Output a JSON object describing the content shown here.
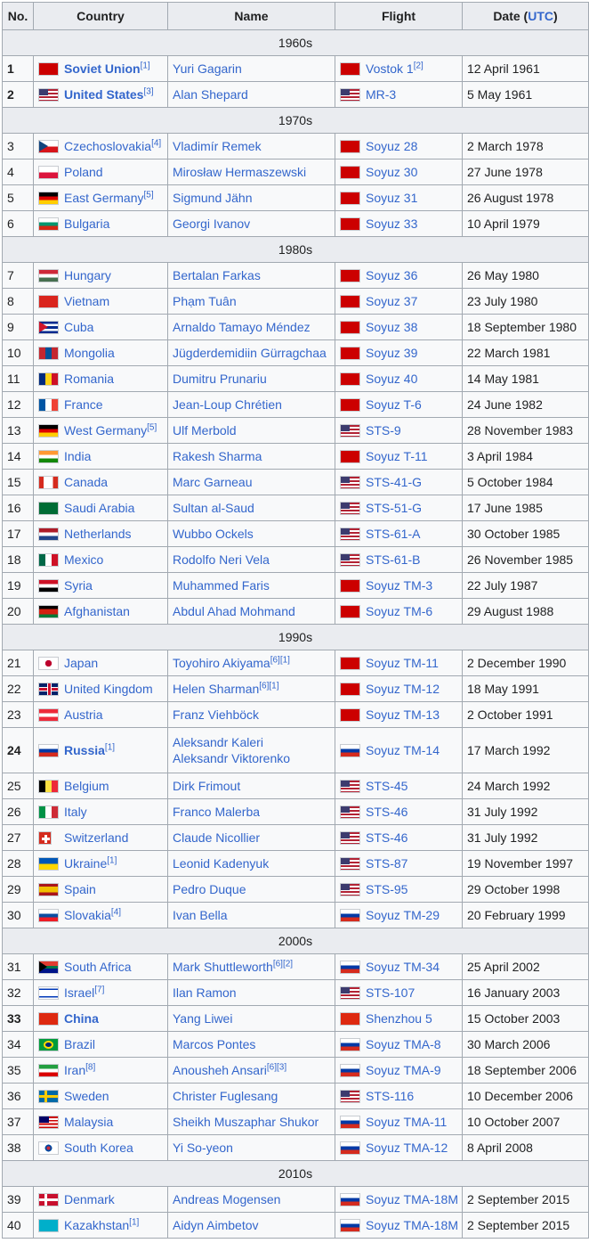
{
  "headers": {
    "no": "No.",
    "country": "Country",
    "name": "Name",
    "flight": "Flight",
    "date_prefix": "Date (",
    "date_link": "UTC",
    "date_suffix": ")"
  },
  "decades": [
    "1960s",
    "1970s",
    "1980s",
    "1990s",
    "2000s",
    "2010s"
  ],
  "rows": [
    {
      "no": "1",
      "bold": true,
      "country": "Soviet Union",
      "country_flag": "ussr-flag-icon",
      "csup": "[1]",
      "name": "Yuri Gagarin",
      "name2": "",
      "nsup": "",
      "flight": "Vostok 1",
      "fsup": "[2]",
      "flight_flag": "ussr-flag-icon",
      "date": "12 April 1961"
    },
    {
      "no": "2",
      "bold": true,
      "country": "United States",
      "country_flag": "usa-flag-icon",
      "csup": "[3]",
      "name": "Alan Shepard",
      "name2": "",
      "nsup": "",
      "flight": "MR-3",
      "fsup": "",
      "flight_flag": "usa-flag-icon",
      "date": "5 May 1961"
    },
    {
      "no": "3",
      "bold": false,
      "country": "Czechoslovakia",
      "country_flag": "czechoslovakia-flag-icon",
      "csup": "[4]",
      "name": "Vladimír Remek",
      "name2": "",
      "nsup": "",
      "flight": "Soyuz 28",
      "fsup": "",
      "flight_flag": "ussr-flag-icon",
      "date": "2 March 1978"
    },
    {
      "no": "4",
      "bold": false,
      "country": "Poland",
      "country_flag": "poland-flag-icon",
      "csup": "",
      "name": "Mirosław Hermaszewski",
      "name2": "",
      "nsup": "",
      "flight": "Soyuz 30",
      "fsup": "",
      "flight_flag": "ussr-flag-icon",
      "date": "27 June 1978"
    },
    {
      "no": "5",
      "bold": false,
      "country": "East Germany",
      "country_flag": "east-germany-flag-icon",
      "csup": "[5]",
      "name": "Sigmund Jähn",
      "name2": "",
      "nsup": "",
      "flight": "Soyuz 31",
      "fsup": "",
      "flight_flag": "ussr-flag-icon",
      "date": "26 August 1978"
    },
    {
      "no": "6",
      "bold": false,
      "country": "Bulgaria",
      "country_flag": "bulgaria-flag-icon",
      "csup": "",
      "name": "Georgi Ivanov",
      "name2": "",
      "nsup": "",
      "flight": "Soyuz 33",
      "fsup": "",
      "flight_flag": "ussr-flag-icon",
      "date": "10 April 1979"
    },
    {
      "no": "7",
      "bold": false,
      "country": "Hungary",
      "country_flag": "hungary-flag-icon",
      "csup": "",
      "name": "Bertalan Farkas",
      "name2": "",
      "nsup": "",
      "flight": "Soyuz 36",
      "fsup": "",
      "flight_flag": "ussr-flag-icon",
      "date": "26 May 1980"
    },
    {
      "no": "8",
      "bold": false,
      "country": "Vietnam",
      "country_flag": "vietnam-flag-icon",
      "csup": "",
      "name": "Phạm Tuân",
      "name2": "",
      "nsup": "",
      "flight": "Soyuz 37",
      "fsup": "",
      "flight_flag": "ussr-flag-icon",
      "date": "23 July 1980"
    },
    {
      "no": "9",
      "bold": false,
      "country": "Cuba",
      "country_flag": "cuba-flag-icon",
      "csup": "",
      "name": "Arnaldo Tamayo Méndez",
      "name2": "",
      "nsup": "",
      "flight": "Soyuz 38",
      "fsup": "",
      "flight_flag": "ussr-flag-icon",
      "date": "18 September 1980"
    },
    {
      "no": "10",
      "bold": false,
      "country": "Mongolia",
      "country_flag": "mongolia-flag-icon",
      "csup": "",
      "name": "Jügderdemidiin Gürragchaa",
      "name2": "",
      "nsup": "",
      "flight": "Soyuz 39",
      "fsup": "",
      "flight_flag": "ussr-flag-icon",
      "date": "22 March 1981"
    },
    {
      "no": "11",
      "bold": false,
      "country": "Romania",
      "country_flag": "romania-flag-icon",
      "csup": "",
      "name": "Dumitru Prunariu",
      "name2": "",
      "nsup": "",
      "flight": "Soyuz 40",
      "fsup": "",
      "flight_flag": "ussr-flag-icon",
      "date": "14 May 1981"
    },
    {
      "no": "12",
      "bold": false,
      "country": "France",
      "country_flag": "france-flag-icon",
      "csup": "",
      "name": "Jean-Loup Chrétien",
      "name2": "",
      "nsup": "",
      "flight": "Soyuz T-6",
      "fsup": "",
      "flight_flag": "ussr-flag-icon",
      "date": "24 June 1982"
    },
    {
      "no": "13",
      "bold": false,
      "country": "West Germany",
      "country_flag": "west-germany-flag-icon",
      "csup": "[5]",
      "name": "Ulf Merbold",
      "name2": "",
      "nsup": "",
      "flight": "STS-9",
      "fsup": "",
      "flight_flag": "usa-flag-icon",
      "date": "28 November 1983"
    },
    {
      "no": "14",
      "bold": false,
      "country": "India",
      "country_flag": "india-flag-icon",
      "csup": "",
      "name": "Rakesh Sharma",
      "name2": "",
      "nsup": "",
      "flight": "Soyuz T-11",
      "fsup": "",
      "flight_flag": "ussr-flag-icon",
      "date": "3 April 1984"
    },
    {
      "no": "15",
      "bold": false,
      "country": "Canada",
      "country_flag": "canada-flag-icon",
      "csup": "",
      "name": "Marc Garneau",
      "name2": "",
      "nsup": "",
      "flight": "STS-41-G",
      "fsup": "",
      "flight_flag": "usa-flag-icon",
      "date": "5 October 1984"
    },
    {
      "no": "16",
      "bold": false,
      "country": "Saudi Arabia",
      "country_flag": "saudi-arabia-flag-icon",
      "csup": "",
      "name": "Sultan al-Saud",
      "name2": "",
      "nsup": "",
      "flight": "STS-51-G",
      "fsup": "",
      "flight_flag": "usa-flag-icon",
      "date": "17 June 1985"
    },
    {
      "no": "17",
      "bold": false,
      "country": "Netherlands",
      "country_flag": "netherlands-flag-icon",
      "csup": "",
      "name": "Wubbo Ockels",
      "name2": "",
      "nsup": "",
      "flight": "STS-61-A",
      "fsup": "",
      "flight_flag": "usa-flag-icon",
      "date": "30 October 1985"
    },
    {
      "no": "18",
      "bold": false,
      "country": "Mexico",
      "country_flag": "mexico-flag-icon",
      "csup": "",
      "name": "Rodolfo Neri Vela",
      "name2": "",
      "nsup": "",
      "flight": "STS-61-B",
      "fsup": "",
      "flight_flag": "usa-flag-icon",
      "date": "26 November 1985"
    },
    {
      "no": "19",
      "bold": false,
      "country": "Syria",
      "country_flag": "syria-flag-icon",
      "csup": "",
      "name": "Muhammed Faris",
      "name2": "",
      "nsup": "",
      "flight": "Soyuz TM-3",
      "fsup": "",
      "flight_flag": "ussr-flag-icon",
      "date": "22 July 1987"
    },
    {
      "no": "20",
      "bold": false,
      "country": "Afghanistan",
      "country_flag": "afghanistan-flag-icon",
      "csup": "",
      "name": "Abdul Ahad Mohmand",
      "name2": "",
      "nsup": "",
      "flight": "Soyuz TM-6",
      "fsup": "",
      "flight_flag": "ussr-flag-icon",
      "date": "29 August 1988"
    },
    {
      "no": "21",
      "bold": false,
      "country": "Japan",
      "country_flag": "japan-flag-icon",
      "csup": "",
      "name": "Toyohiro Akiyama",
      "name2": "",
      "nsup": "[6][1]",
      "flight": "Soyuz TM-11",
      "fsup": "",
      "flight_flag": "ussr-flag-icon",
      "date": "2 December 1990"
    },
    {
      "no": "22",
      "bold": false,
      "country": "United Kingdom",
      "country_flag": "united-kingdom-flag-icon",
      "csup": "",
      "name": "Helen Sharman",
      "name2": "",
      "nsup": "[6][1]",
      "flight": "Soyuz TM-12",
      "fsup": "",
      "flight_flag": "ussr-flag-icon",
      "date": "18 May 1991"
    },
    {
      "no": "23",
      "bold": false,
      "country": "Austria",
      "country_flag": "austria-flag-icon",
      "csup": "",
      "name": "Franz Viehböck",
      "name2": "",
      "nsup": "",
      "flight": "Soyuz TM-13",
      "fsup": "",
      "flight_flag": "ussr-flag-icon",
      "date": "2 October 1991"
    },
    {
      "no": "24",
      "bold": true,
      "country": "Russia",
      "country_flag": "russia-flag-icon",
      "csup": "[1]",
      "name": "Aleksandr Kaleri",
      "name2": "Aleksandr Viktorenko",
      "nsup": "",
      "flight": "Soyuz TM-14",
      "fsup": "",
      "flight_flag": "russia-flag-icon",
      "date": "17 March 1992"
    },
    {
      "no": "25",
      "bold": false,
      "country": "Belgium",
      "country_flag": "belgium-flag-icon",
      "csup": "",
      "name": "Dirk Frimout",
      "name2": "",
      "nsup": "",
      "flight": "STS-45",
      "fsup": "",
      "flight_flag": "usa-flag-icon",
      "date": "24 March 1992"
    },
    {
      "no": "26",
      "bold": false,
      "country": "Italy",
      "country_flag": "italy-flag-icon",
      "csup": "",
      "name": "Franco Malerba",
      "name2": "",
      "nsup": "",
      "flight": "STS-46",
      "fsup": "",
      "flight_flag": "usa-flag-icon",
      "date": "31 July 1992"
    },
    {
      "no": "27",
      "bold": false,
      "country": "Switzerland",
      "country_flag": "switzerland-flag-icon",
      "csup": "",
      "name": "Claude Nicollier",
      "name2": "",
      "nsup": "",
      "flight": "STS-46",
      "fsup": "",
      "flight_flag": "usa-flag-icon",
      "date": "31 July 1992"
    },
    {
      "no": "28",
      "bold": false,
      "country": "Ukraine",
      "country_flag": "ukraine-flag-icon",
      "csup": "[1]",
      "name": "Leonid Kadenyuk",
      "name2": "",
      "nsup": "",
      "flight": "STS-87",
      "fsup": "",
      "flight_flag": "usa-flag-icon",
      "date": "19 November 1997"
    },
    {
      "no": "29",
      "bold": false,
      "country": "Spain",
      "country_flag": "spain-flag-icon",
      "csup": "",
      "name": "Pedro Duque",
      "name2": "",
      "nsup": "",
      "flight": "STS-95",
      "fsup": "",
      "flight_flag": "usa-flag-icon",
      "date": "29 October 1998"
    },
    {
      "no": "30",
      "bold": false,
      "country": "Slovakia",
      "country_flag": "slovakia-flag-icon",
      "csup": "[4]",
      "name": "Ivan Bella",
      "name2": "",
      "nsup": "",
      "flight": "Soyuz TM-29",
      "fsup": "",
      "flight_flag": "russia-flag-icon",
      "date": "20 February 1999"
    },
    {
      "no": "31",
      "bold": false,
      "country": "South Africa",
      "country_flag": "south-africa-flag-icon",
      "csup": "",
      "name": "Mark Shuttleworth",
      "name2": "",
      "nsup": "[6][2]",
      "flight": "Soyuz TM-34",
      "fsup": "",
      "flight_flag": "russia-flag-icon",
      "date": "25 April 2002"
    },
    {
      "no": "32",
      "bold": false,
      "country": "Israel",
      "country_flag": "israel-flag-icon",
      "csup": "[7]",
      "name": "Ilan Ramon",
      "name2": "",
      "nsup": "",
      "flight": "STS-107",
      "fsup": "",
      "flight_flag": "usa-flag-icon",
      "date": "16 January 2003"
    },
    {
      "no": "33",
      "bold": true,
      "country": "China",
      "country_flag": "china-flag-icon",
      "csup": "",
      "name": "Yang Liwei",
      "name2": "",
      "nsup": "",
      "flight": "Shenzhou 5",
      "fsup": "",
      "flight_flag": "china-flag-icon",
      "date": "15 October 2003"
    },
    {
      "no": "34",
      "bold": false,
      "country": "Brazil",
      "country_flag": "brazil-flag-icon",
      "csup": "",
      "name": "Marcos Pontes",
      "name2": "",
      "nsup": "",
      "flight": "Soyuz TMA-8",
      "fsup": "",
      "flight_flag": "russia-flag-icon",
      "date": "30 March 2006"
    },
    {
      "no": "35",
      "bold": false,
      "country": "Iran",
      "country_flag": "iran-flag-icon",
      "csup": "[8]",
      "name": "Anousheh Ansari",
      "name2": "",
      "nsup": "[6][3]",
      "flight": "Soyuz TMA-9",
      "fsup": "",
      "flight_flag": "russia-flag-icon",
      "date": "18 September 2006"
    },
    {
      "no": "36",
      "bold": false,
      "country": "Sweden",
      "country_flag": "sweden-flag-icon",
      "csup": "",
      "name": "Christer Fuglesang",
      "name2": "",
      "nsup": "",
      "flight": "STS-116",
      "fsup": "",
      "flight_flag": "usa-flag-icon",
      "date": "10 December 2006"
    },
    {
      "no": "37",
      "bold": false,
      "country": "Malaysia",
      "country_flag": "malaysia-flag-icon",
      "csup": "",
      "name": "Sheikh Muszaphar Shukor",
      "name2": "",
      "nsup": "",
      "flight": "Soyuz TMA-11",
      "fsup": "",
      "flight_flag": "russia-flag-icon",
      "date": "10 October 2007"
    },
    {
      "no": "38",
      "bold": false,
      "country": "South Korea",
      "country_flag": "south-korea-flag-icon",
      "csup": "",
      "name": "Yi So-yeon",
      "name2": "",
      "nsup": "",
      "flight": "Soyuz TMA-12",
      "fsup": "",
      "flight_flag": "russia-flag-icon",
      "date": "8 April 2008"
    },
    {
      "no": "39",
      "bold": false,
      "country": "Denmark",
      "country_flag": "denmark-flag-icon",
      "csup": "",
      "name": "Andreas Mogensen",
      "name2": "",
      "nsup": "",
      "flight": "Soyuz TMA-18M",
      "fsup": "",
      "flight_flag": "russia-flag-icon",
      "date": "2 September 2015"
    },
    {
      "no": "40",
      "bold": false,
      "country": "Kazakhstan",
      "country_flag": "kazakhstan-flag-icon",
      "csup": "[1]",
      "name": "Aidyn Aimbetov",
      "name2": "",
      "nsup": "",
      "flight": "Soyuz TMA-18M",
      "fsup": "",
      "flight_flag": "russia-flag-icon",
      "date": "2 September 2015"
    }
  ]
}
